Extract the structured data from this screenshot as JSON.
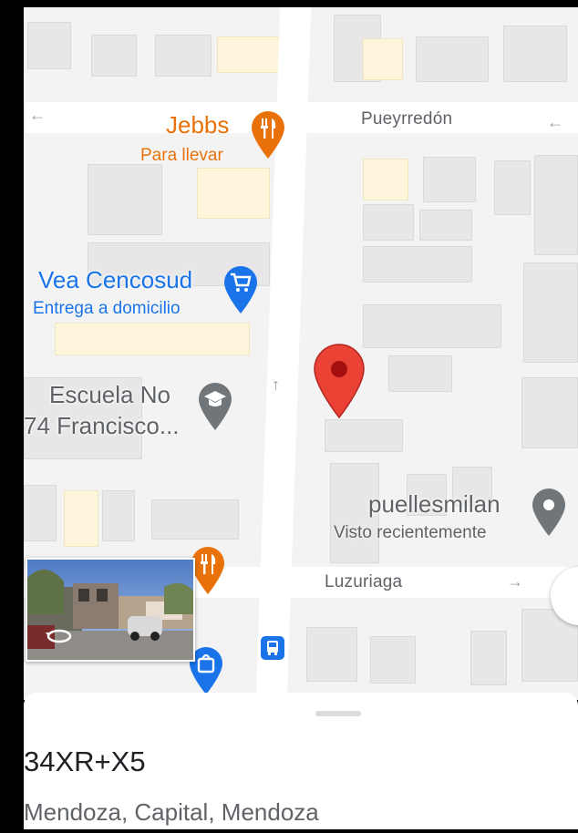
{
  "streets": {
    "top": "Pueyrredón",
    "bottom": "Luzuriaga"
  },
  "pois": {
    "jebbs": {
      "name": "Jebbs",
      "sub": "Para llevar",
      "icon": "restaurant-icon",
      "color": "#e8710a"
    },
    "vea": {
      "name": "Vea Cencosud",
      "sub": "Entrega a domicilio",
      "icon": "shopping-cart-icon",
      "color": "#1a73e8"
    },
    "escuela": {
      "line1": "Escuela No",
      "line2": "74 Francisco...",
      "icon": "school-icon",
      "color": "#5f6368"
    },
    "puelles": {
      "name": "puellesmilan",
      "sub": "Visto recientemente",
      "icon": "place-icon",
      "color": "#5f6368"
    }
  },
  "marker": {
    "icon": "location-pin-icon",
    "color": "#ea4335"
  },
  "street_view_thumbnail": {
    "icon": "rotate-360-icon"
  },
  "bus_stop": {
    "icon": "bus-icon",
    "color": "#1a73e8"
  },
  "place": {
    "plus_code": "34XR+X5",
    "address": "Mendoza, Capital, Mendoza"
  }
}
